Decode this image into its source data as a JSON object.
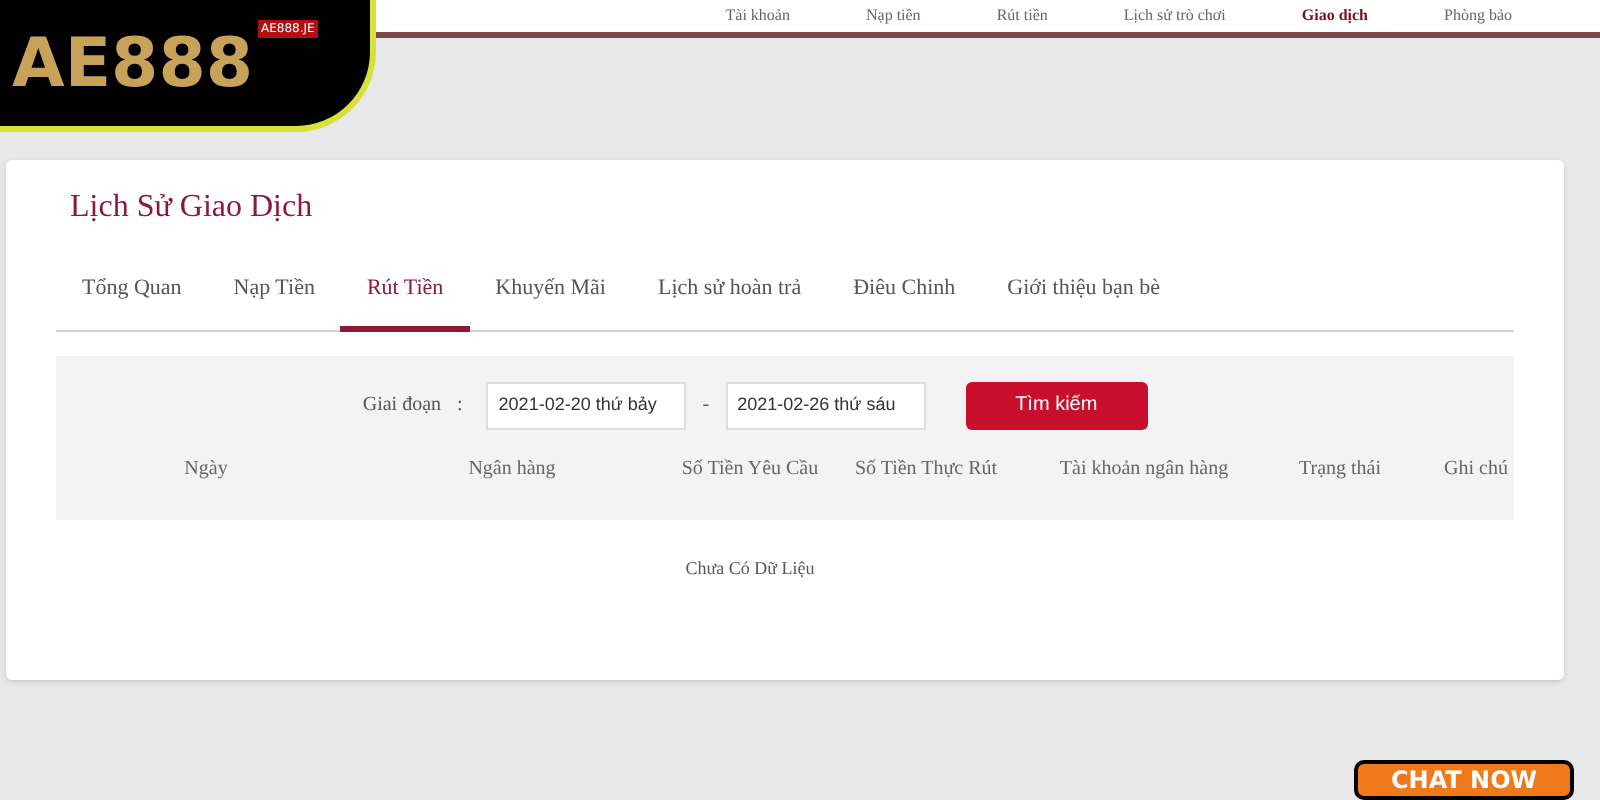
{
  "logo": {
    "text": "AE888",
    "badge": "AE888.JE"
  },
  "top_nav": [
    {
      "label": "Tài khoản",
      "selected": false
    },
    {
      "label": "Nạp tiền",
      "selected": false
    },
    {
      "label": "Rút tiền",
      "selected": false
    },
    {
      "label": "Lịch sử trò chơi",
      "selected": false
    },
    {
      "label": "Giao dịch",
      "selected": true
    },
    {
      "label": "Phòng bảo",
      "selected": false
    }
  ],
  "card": {
    "title": "Lịch Sử Giao Dịch",
    "tabs": [
      {
        "label": "Tổng Quan",
        "selected": false
      },
      {
        "label": "Nạp Tiền",
        "selected": false
      },
      {
        "label": "Rút Tiền",
        "selected": true
      },
      {
        "label": "Khuyến Mãi",
        "selected": false
      },
      {
        "label": "Lịch sử hoàn trả",
        "selected": false
      },
      {
        "label": "Điêu Chinh",
        "selected": false
      },
      {
        "label": "Giới thiệu bạn bè",
        "selected": false
      }
    ],
    "filter": {
      "label": "Giai đoạn",
      "colon": ":",
      "from": "2021-02-20 thứ bảy",
      "separator": "-",
      "to": "2021-02-26 thứ sáu",
      "button": "Tìm kiếm"
    },
    "table": {
      "columns": [
        "Ngày",
        "Ngân hàng",
        "Số Tiền Yêu Cầu",
        "Số Tiền Thực Rút",
        "Tài khoản ngân hàng",
        "Trạng thái",
        "Ghi chú"
      ],
      "empty": "Chưa Có Dữ Liệu"
    }
  },
  "chat_button": "CHAT NOW"
}
